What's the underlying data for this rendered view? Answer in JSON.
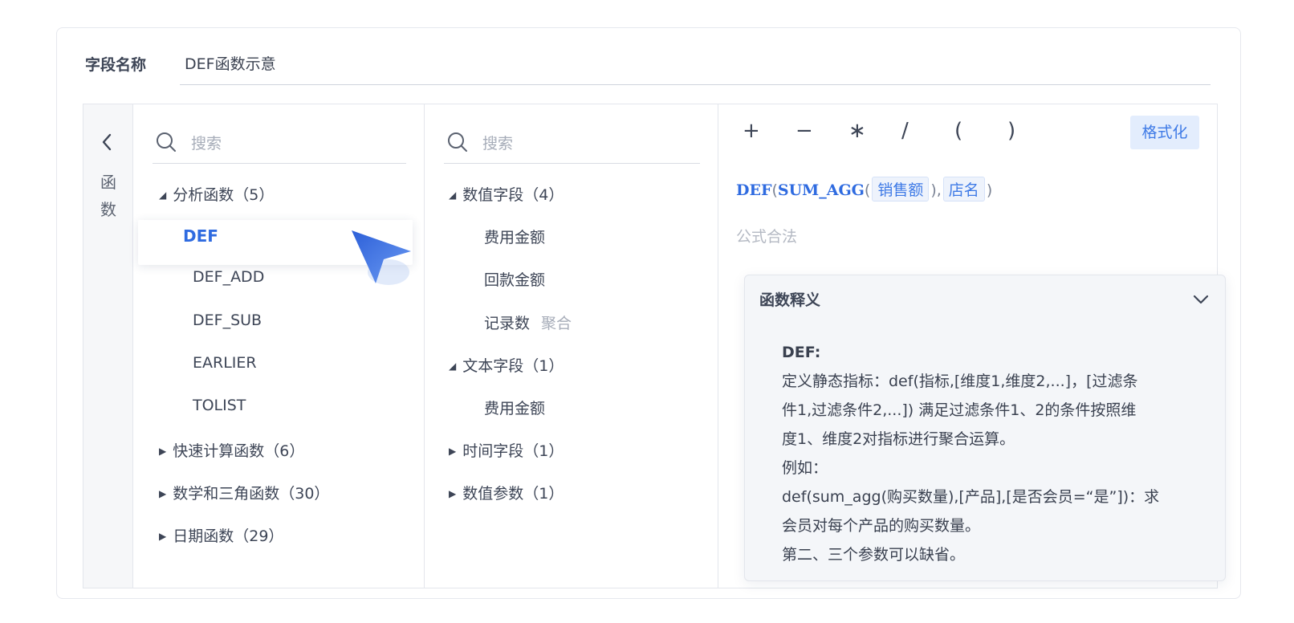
{
  "field": {
    "label": "字段名称",
    "value": "DEF函数示意"
  },
  "collapse": {
    "icon": "chevron-left-icon",
    "vertical_label": "函数"
  },
  "function_panel": {
    "search_placeholder": "搜索",
    "groups": [
      {
        "label": "分析函数（5）",
        "expanded": true
      },
      {
        "label": "快速计算函数（6）",
        "expanded": false
      },
      {
        "label": "数学和三角函数（30）",
        "expanded": false
      },
      {
        "label": "日期函数（29）",
        "expanded": false
      }
    ],
    "items": [
      "DEF",
      "DEF_ADD",
      "DEF_SUB",
      "EARLIER",
      "TOLIST"
    ],
    "selected": "DEF"
  },
  "field_panel": {
    "search_placeholder": "搜索",
    "groups": [
      {
        "label": "数值字段（4）",
        "expanded": true
      },
      {
        "label": "文本字段（1）",
        "expanded": true
      },
      {
        "label": "时间字段（1）",
        "expanded": false
      },
      {
        "label": "数值参数（1）",
        "expanded": false
      }
    ],
    "numeric_items": [
      "费用金额",
      "回款金额",
      "记录数"
    ],
    "record_tag": "聚合",
    "text_items": [
      "费用金额"
    ]
  },
  "formula_panel": {
    "operators": [
      "+",
      "−",
      "∗",
      "/",
      "(",
      ")"
    ],
    "format_button": "格式化",
    "formula": {
      "fn_outer": "DEF",
      "fn_inner": "SUM_AGG",
      "arg1": "销售额",
      "arg2": "店名"
    },
    "status": "公式合法"
  },
  "explain_popup": {
    "title": "函数释义",
    "heading": "DEF:",
    "lines": [
      "定义静态指标：def(指标,[维度1,维度2,...]，[过滤条",
      "件1,过滤条件2,...]) 满足过滤条件1、2的条件按照维",
      "度1、维度2对指标进行聚合运算。",
      "例如：",
      "def(sum_agg(购买数量),[产品],[是否会员=“是”])：求",
      "会员对每个产品的购买数量。",
      "第二、三个参数可以缺省。"
    ]
  },
  "colors": {
    "accent": "#2f6be0",
    "chip_bg": "#eef3fc",
    "format_bg": "#e3edfd"
  }
}
